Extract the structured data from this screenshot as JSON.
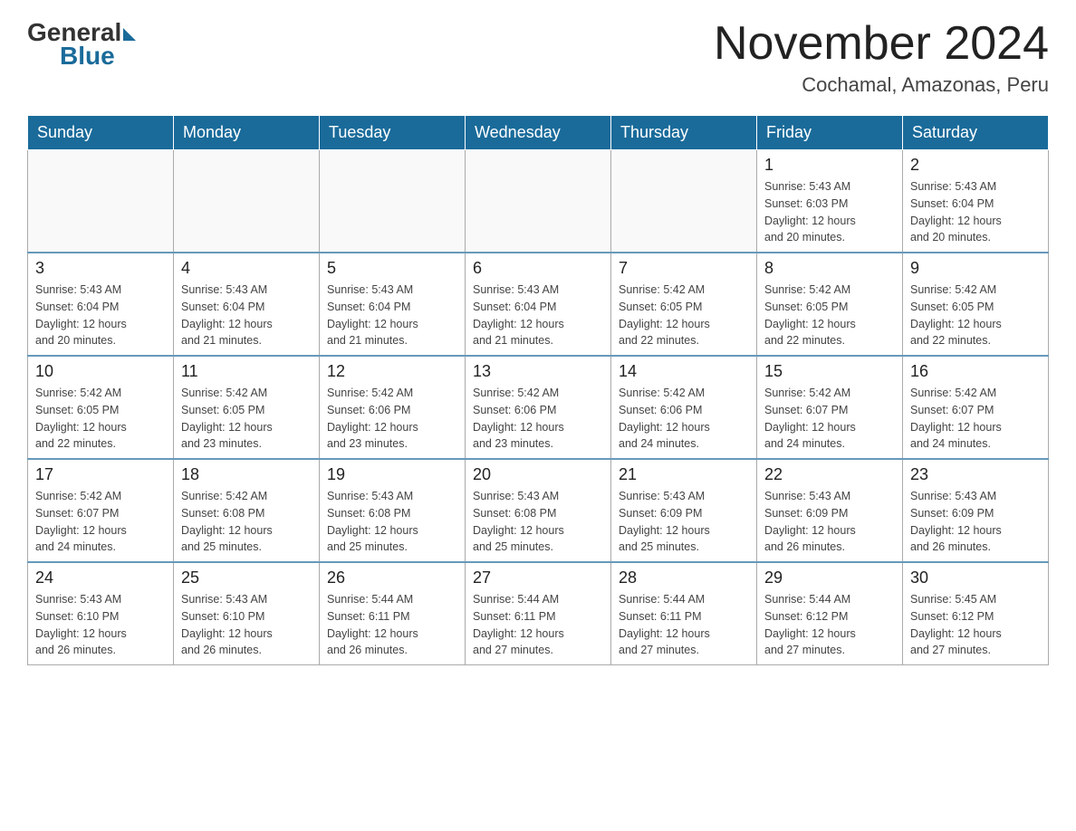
{
  "header": {
    "logo": {
      "general": "General",
      "blue": "Blue"
    },
    "title": "November 2024",
    "location": "Cochamal, Amazonas, Peru"
  },
  "calendar": {
    "weekdays": [
      "Sunday",
      "Monday",
      "Tuesday",
      "Wednesday",
      "Thursday",
      "Friday",
      "Saturday"
    ],
    "weeks": [
      [
        {
          "day": "",
          "info": ""
        },
        {
          "day": "",
          "info": ""
        },
        {
          "day": "",
          "info": ""
        },
        {
          "day": "",
          "info": ""
        },
        {
          "day": "",
          "info": ""
        },
        {
          "day": "1",
          "info": "Sunrise: 5:43 AM\nSunset: 6:03 PM\nDaylight: 12 hours\nand 20 minutes."
        },
        {
          "day": "2",
          "info": "Sunrise: 5:43 AM\nSunset: 6:04 PM\nDaylight: 12 hours\nand 20 minutes."
        }
      ],
      [
        {
          "day": "3",
          "info": "Sunrise: 5:43 AM\nSunset: 6:04 PM\nDaylight: 12 hours\nand 20 minutes."
        },
        {
          "day": "4",
          "info": "Sunrise: 5:43 AM\nSunset: 6:04 PM\nDaylight: 12 hours\nand 21 minutes."
        },
        {
          "day": "5",
          "info": "Sunrise: 5:43 AM\nSunset: 6:04 PM\nDaylight: 12 hours\nand 21 minutes."
        },
        {
          "day": "6",
          "info": "Sunrise: 5:43 AM\nSunset: 6:04 PM\nDaylight: 12 hours\nand 21 minutes."
        },
        {
          "day": "7",
          "info": "Sunrise: 5:42 AM\nSunset: 6:05 PM\nDaylight: 12 hours\nand 22 minutes."
        },
        {
          "day": "8",
          "info": "Sunrise: 5:42 AM\nSunset: 6:05 PM\nDaylight: 12 hours\nand 22 minutes."
        },
        {
          "day": "9",
          "info": "Sunrise: 5:42 AM\nSunset: 6:05 PM\nDaylight: 12 hours\nand 22 minutes."
        }
      ],
      [
        {
          "day": "10",
          "info": "Sunrise: 5:42 AM\nSunset: 6:05 PM\nDaylight: 12 hours\nand 22 minutes."
        },
        {
          "day": "11",
          "info": "Sunrise: 5:42 AM\nSunset: 6:05 PM\nDaylight: 12 hours\nand 23 minutes."
        },
        {
          "day": "12",
          "info": "Sunrise: 5:42 AM\nSunset: 6:06 PM\nDaylight: 12 hours\nand 23 minutes."
        },
        {
          "day": "13",
          "info": "Sunrise: 5:42 AM\nSunset: 6:06 PM\nDaylight: 12 hours\nand 23 minutes."
        },
        {
          "day": "14",
          "info": "Sunrise: 5:42 AM\nSunset: 6:06 PM\nDaylight: 12 hours\nand 24 minutes."
        },
        {
          "day": "15",
          "info": "Sunrise: 5:42 AM\nSunset: 6:07 PM\nDaylight: 12 hours\nand 24 minutes."
        },
        {
          "day": "16",
          "info": "Sunrise: 5:42 AM\nSunset: 6:07 PM\nDaylight: 12 hours\nand 24 minutes."
        }
      ],
      [
        {
          "day": "17",
          "info": "Sunrise: 5:42 AM\nSunset: 6:07 PM\nDaylight: 12 hours\nand 24 minutes."
        },
        {
          "day": "18",
          "info": "Sunrise: 5:42 AM\nSunset: 6:08 PM\nDaylight: 12 hours\nand 25 minutes."
        },
        {
          "day": "19",
          "info": "Sunrise: 5:43 AM\nSunset: 6:08 PM\nDaylight: 12 hours\nand 25 minutes."
        },
        {
          "day": "20",
          "info": "Sunrise: 5:43 AM\nSunset: 6:08 PM\nDaylight: 12 hours\nand 25 minutes."
        },
        {
          "day": "21",
          "info": "Sunrise: 5:43 AM\nSunset: 6:09 PM\nDaylight: 12 hours\nand 25 minutes."
        },
        {
          "day": "22",
          "info": "Sunrise: 5:43 AM\nSunset: 6:09 PM\nDaylight: 12 hours\nand 26 minutes."
        },
        {
          "day": "23",
          "info": "Sunrise: 5:43 AM\nSunset: 6:09 PM\nDaylight: 12 hours\nand 26 minutes."
        }
      ],
      [
        {
          "day": "24",
          "info": "Sunrise: 5:43 AM\nSunset: 6:10 PM\nDaylight: 12 hours\nand 26 minutes."
        },
        {
          "day": "25",
          "info": "Sunrise: 5:43 AM\nSunset: 6:10 PM\nDaylight: 12 hours\nand 26 minutes."
        },
        {
          "day": "26",
          "info": "Sunrise: 5:44 AM\nSunset: 6:11 PM\nDaylight: 12 hours\nand 26 minutes."
        },
        {
          "day": "27",
          "info": "Sunrise: 5:44 AM\nSunset: 6:11 PM\nDaylight: 12 hours\nand 27 minutes."
        },
        {
          "day": "28",
          "info": "Sunrise: 5:44 AM\nSunset: 6:11 PM\nDaylight: 12 hours\nand 27 minutes."
        },
        {
          "day": "29",
          "info": "Sunrise: 5:44 AM\nSunset: 6:12 PM\nDaylight: 12 hours\nand 27 minutes."
        },
        {
          "day": "30",
          "info": "Sunrise: 5:45 AM\nSunset: 6:12 PM\nDaylight: 12 hours\nand 27 minutes."
        }
      ]
    ]
  }
}
